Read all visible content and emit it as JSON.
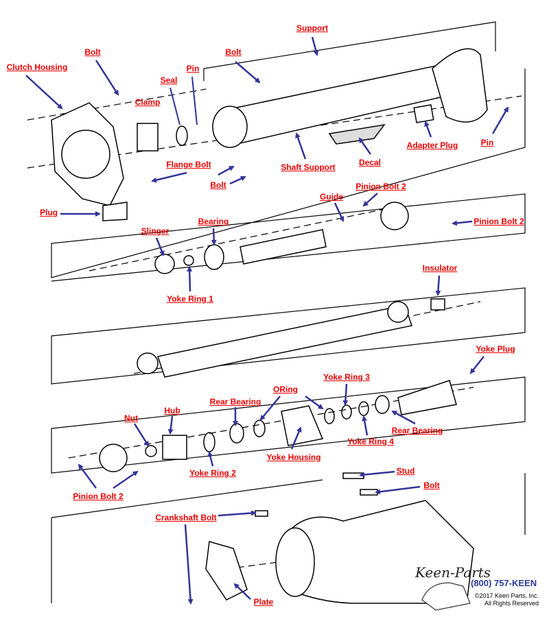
{
  "labels": {
    "support": "Support",
    "bolt_top_left": "Bolt",
    "clutch_housing": "Clutch Housing",
    "bolt_top": "Bolt",
    "pin_left": "Pin",
    "seal": "Seal",
    "clamp": "Clamp",
    "flange_bolt": "Flange Bolt",
    "bolt_mid": "Bolt",
    "shaft_support": "Shaft Support",
    "decal": "Decal",
    "adapter_plug": "Adapter Plug",
    "pin_right": "Pin",
    "plug": "Plug",
    "pinion_bolt_2_top": "Pinion Bolt 2",
    "guide": "Guide",
    "pinion_bolt_2_right": "Pinion Bolt 2",
    "slinger": "Slinger",
    "bearing": "Bearing",
    "yoke_ring_1": "Yoke Ring 1",
    "insulator": "Insulator",
    "yoke_plug": "Yoke Plug",
    "yoke_ring_3": "Yoke Ring 3",
    "oring": "ORing",
    "rear_bearing_left": "Rear Bearing",
    "hub": "Hub",
    "nut": "Nut",
    "rear_bearing_right": "Rear Bearing",
    "yoke_ring_4": "Yoke Ring 4",
    "yoke_housing": "Yoke Housing",
    "yoke_ring_2": "Yoke Ring 2",
    "pinion_bolt_2_bottom": "Pinion Bolt 2",
    "stud": "Stud",
    "bolt_bottom": "Bolt",
    "crankshaft_bolt": "Crankshaft Bolt",
    "plate": "Plate"
  },
  "branding": {
    "logo_text": "Keen Parts",
    "phone": "(800) 757-KEEN",
    "copyright": "©2017 Keen Parts, Inc.",
    "rights": "All Rights Reserved"
  },
  "colors": {
    "label": "#ee0000",
    "arrow": "#333399",
    "phone": "#2a3a9a"
  }
}
